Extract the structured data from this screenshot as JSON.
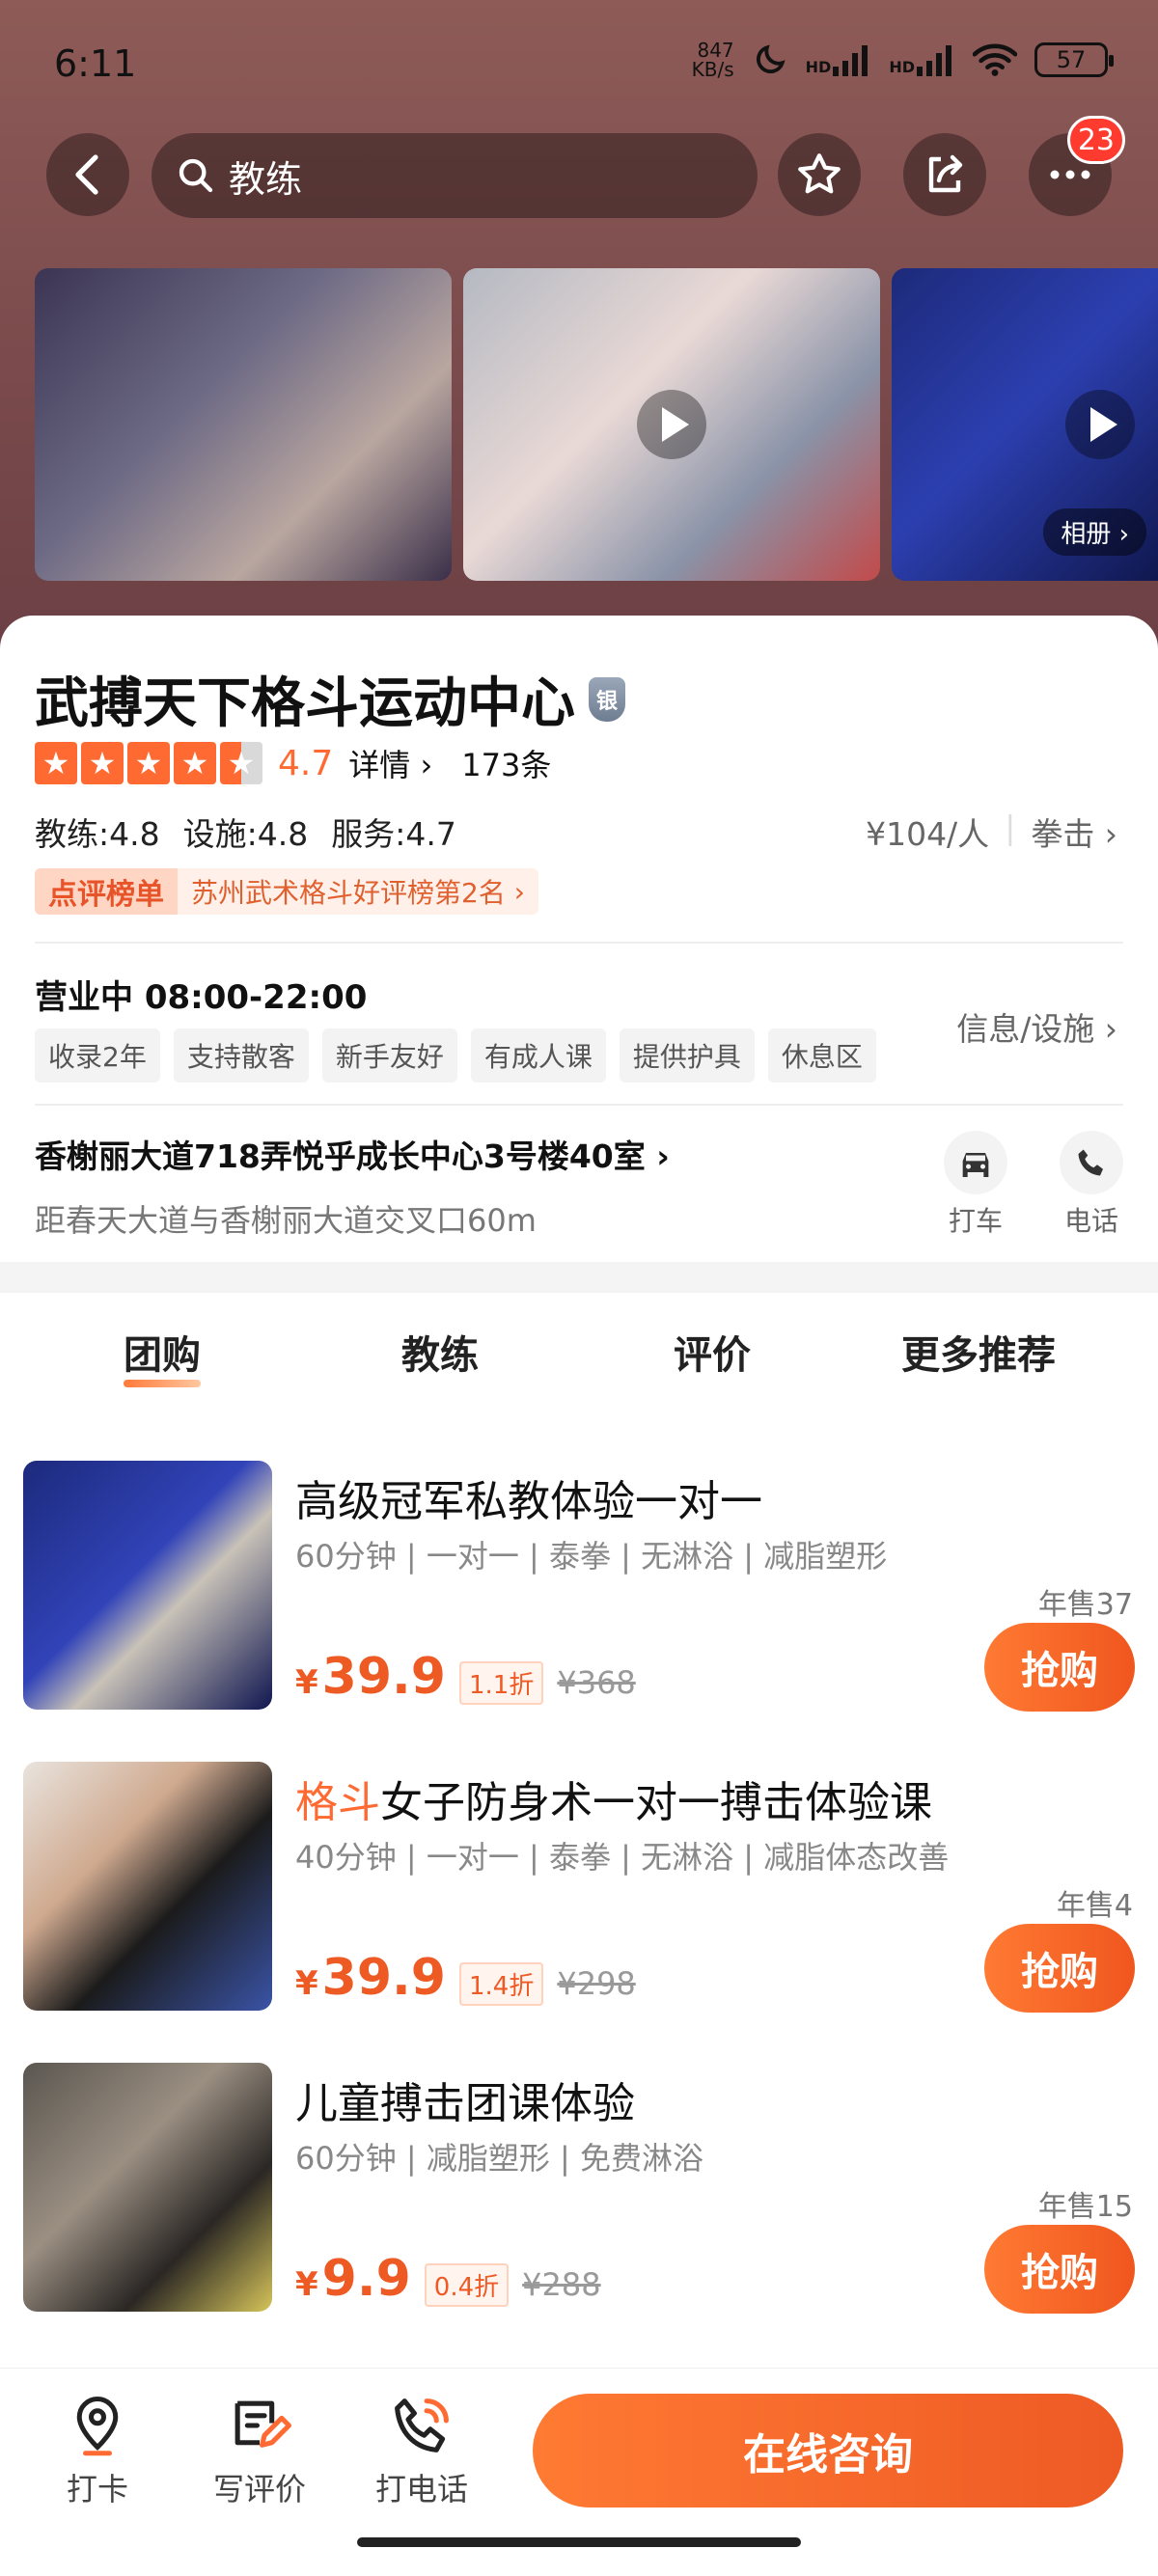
{
  "status": {
    "time": "6:11",
    "net_speed_top": "847",
    "net_speed_bottom": "KB/s",
    "hd1": "HD",
    "hd2": "HD",
    "battery": "57"
  },
  "nav": {
    "search_text": "教练",
    "notifications": "23"
  },
  "gallery": {
    "album_label": "相册"
  },
  "shop": {
    "name": "武搏天下格斗运动中心",
    "level_badge": "银",
    "rating": "4.7",
    "details_label": "详情",
    "review_count": "173条",
    "scores": [
      "教练:4.8",
      "设施:4.8",
      "服务:4.7"
    ],
    "price_per_person": "¥104/人",
    "category": "拳击",
    "rank_tag": "点评榜单",
    "rank_text": "苏州武术格斗好评榜第2名",
    "status_hours": "营业中 08:00-22:00",
    "tags": [
      "收录2年",
      "支持散客",
      "新手友好",
      "有成人课",
      "提供护具",
      "休息区"
    ],
    "info_link": "信息/设施",
    "address": "香榭丽大道718弄悦乎成长中心3号楼40室",
    "distance": "距春天大道与香榭丽大道交叉口60m",
    "taxi_label": "打车",
    "phone_label": "电话"
  },
  "tabs": [
    "团购",
    "教练",
    "评价",
    "更多推荐"
  ],
  "deals": [
    {
      "title_hl": "",
      "title": "高级冠军私教体验一对一",
      "meta": "60分钟 | 一对一 | 泰拳 | 无淋浴 | 减脂塑形",
      "sold": "年售37",
      "currency": "¥",
      "price": "39.9",
      "discount": "1.1折",
      "original": "¥368",
      "buy": "抢购"
    },
    {
      "title_hl": "格斗",
      "title": "女子防身术一对一搏击体验课",
      "meta": "40分钟 | 一对一 | 泰拳 | 无淋浴 | 减脂体态改善",
      "sold": "年售4",
      "currency": "¥",
      "price": "39.9",
      "discount": "1.4折",
      "original": "¥298",
      "buy": "抢购"
    },
    {
      "title_hl": "",
      "title": "儿童搏击团课体验",
      "meta": "60分钟 | 减脂塑形 | 免费淋浴",
      "sold": "年售15",
      "currency": "¥",
      "price": "9.9",
      "discount": "0.4折",
      "original": "¥288",
      "buy": "抢购"
    }
  ],
  "bottom": {
    "checkin": "打卡",
    "review": "写评价",
    "call": "打电话",
    "consult": "在线咨询"
  },
  "colors": {
    "accent": "#ff6a33",
    "price": "#ee5a24"
  }
}
